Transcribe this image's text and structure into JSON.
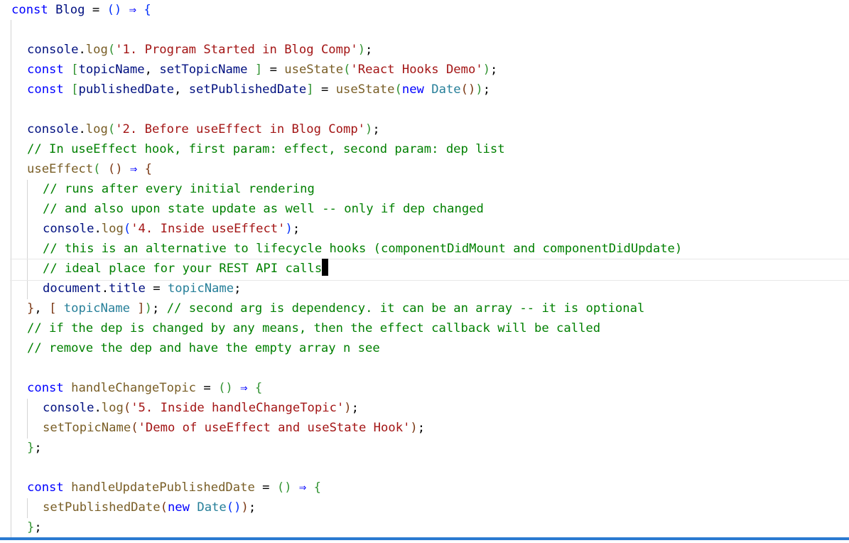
{
  "editor": {
    "language": "javascript",
    "lines": [
      {
        "tokens": [
          {
            "t": "const",
            "c": "k"
          },
          {
            "t": " ",
            "c": "p"
          },
          {
            "t": "Blog",
            "c": "v"
          },
          {
            "t": " = ",
            "c": "p"
          },
          {
            "t": "()",
            "c": "b1"
          },
          {
            "t": " ",
            "c": "p"
          },
          {
            "t": "⇒",
            "c": "k"
          },
          {
            "t": " ",
            "c": "p"
          },
          {
            "t": "{",
            "c": "b1"
          }
        ]
      },
      {
        "tokens": []
      },
      {
        "tokens": [
          {
            "t": "console",
            "c": "v"
          },
          {
            "t": ".",
            "c": "p"
          },
          {
            "t": "log",
            "c": "f"
          },
          {
            "t": "(",
            "c": "b2"
          },
          {
            "t": "'1. Program Started in Blog Comp'",
            "c": "s"
          },
          {
            "t": ")",
            "c": "b2"
          },
          {
            "t": ";",
            "c": "p"
          }
        ]
      },
      {
        "tokens": [
          {
            "t": "const",
            "c": "k"
          },
          {
            "t": " ",
            "c": "p"
          },
          {
            "t": "[",
            "c": "b2"
          },
          {
            "t": "topicName",
            "c": "v"
          },
          {
            "t": ", ",
            "c": "p"
          },
          {
            "t": "setTopicName",
            "c": "v"
          },
          {
            "t": " ",
            "c": "p"
          },
          {
            "t": "]",
            "c": "b2"
          },
          {
            "t": " = ",
            "c": "p"
          },
          {
            "t": "useState",
            "c": "f"
          },
          {
            "t": "(",
            "c": "b2"
          },
          {
            "t": "'React Hooks Demo'",
            "c": "s"
          },
          {
            "t": ")",
            "c": "b2"
          },
          {
            "t": ";",
            "c": "p"
          }
        ]
      },
      {
        "tokens": [
          {
            "t": "const",
            "c": "k"
          },
          {
            "t": " ",
            "c": "p"
          },
          {
            "t": "[",
            "c": "b2"
          },
          {
            "t": "publishedDate",
            "c": "v"
          },
          {
            "t": ", ",
            "c": "p"
          },
          {
            "t": "setPublishedDate",
            "c": "v"
          },
          {
            "t": "]",
            "c": "b2"
          },
          {
            "t": " = ",
            "c": "p"
          },
          {
            "t": "useState",
            "c": "f"
          },
          {
            "t": "(",
            "c": "b2"
          },
          {
            "t": "new",
            "c": "k"
          },
          {
            "t": " ",
            "c": "p"
          },
          {
            "t": "Date",
            "c": "t"
          },
          {
            "t": "()",
            "c": "b3"
          },
          {
            "t": ")",
            "c": "b2"
          },
          {
            "t": ";",
            "c": "p"
          }
        ]
      },
      {
        "tokens": []
      },
      {
        "tokens": [
          {
            "t": "console",
            "c": "v"
          },
          {
            "t": ".",
            "c": "p"
          },
          {
            "t": "log",
            "c": "f"
          },
          {
            "t": "(",
            "c": "b2"
          },
          {
            "t": "'2. Before useEffect in Blog Comp'",
            "c": "s"
          },
          {
            "t": ")",
            "c": "b2"
          },
          {
            "t": ";",
            "c": "p"
          }
        ]
      },
      {
        "tokens": [
          {
            "t": "// In useEffect hook, first param: effect, second param: dep list",
            "c": "c"
          }
        ]
      },
      {
        "tokens": [
          {
            "t": "useEffect",
            "c": "f"
          },
          {
            "t": "(",
            "c": "b2"
          },
          {
            "t": " ",
            "c": "p"
          },
          {
            "t": "()",
            "c": "b3"
          },
          {
            "t": " ",
            "c": "p"
          },
          {
            "t": "⇒",
            "c": "k"
          },
          {
            "t": " ",
            "c": "p"
          },
          {
            "t": "{",
            "c": "b3"
          }
        ]
      },
      {
        "tokens": [
          {
            "t": "// runs after every initial rendering",
            "c": "c"
          }
        ]
      },
      {
        "tokens": [
          {
            "t": "// and also upon state update as well -- only if dep changed",
            "c": "c"
          }
        ]
      },
      {
        "tokens": [
          {
            "t": "console",
            "c": "v"
          },
          {
            "t": ".",
            "c": "p"
          },
          {
            "t": "log",
            "c": "f"
          },
          {
            "t": "(",
            "c": "b1"
          },
          {
            "t": "'4. Inside useEffect'",
            "c": "s"
          },
          {
            "t": ")",
            "c": "b1"
          },
          {
            "t": ";",
            "c": "p"
          }
        ]
      },
      {
        "tokens": [
          {
            "t": "// this is an alternative to lifecycle hooks (componentDidMount and componentDidUpdate)",
            "c": "c"
          }
        ]
      },
      {
        "tokens": [
          {
            "t": "// ideal place for your REST API calls",
            "c": "c"
          }
        ]
      },
      {
        "tokens": [
          {
            "t": "document",
            "c": "v"
          },
          {
            "t": ".",
            "c": "p"
          },
          {
            "t": "title",
            "c": "v"
          },
          {
            "t": " = ",
            "c": "p"
          },
          {
            "t": "topicName",
            "c": "t"
          },
          {
            "t": ";",
            "c": "p"
          }
        ]
      },
      {
        "tokens": [
          {
            "t": "}",
            "c": "b3"
          },
          {
            "t": ", ",
            "c": "p"
          },
          {
            "t": "[",
            "c": "b3"
          },
          {
            "t": " ",
            "c": "p"
          },
          {
            "t": "topicName",
            "c": "t"
          },
          {
            "t": " ",
            "c": "p"
          },
          {
            "t": "]",
            "c": "b3"
          },
          {
            "t": ")",
            "c": "b2"
          },
          {
            "t": "; ",
            "c": "p"
          },
          {
            "t": "// second arg is dependency. it can be an array -- it is optional",
            "c": "c"
          }
        ]
      },
      {
        "tokens": [
          {
            "t": "// if the dep is changed by any means, then the effect callback will be called",
            "c": "c"
          }
        ]
      },
      {
        "tokens": [
          {
            "t": "// remove the dep and have the empty array n see",
            "c": "c"
          }
        ]
      },
      {
        "tokens": []
      },
      {
        "tokens": [
          {
            "t": "const",
            "c": "k"
          },
          {
            "t": " ",
            "c": "p"
          },
          {
            "t": "handleChangeTopic",
            "c": "f"
          },
          {
            "t": " = ",
            "c": "p"
          },
          {
            "t": "()",
            "c": "b2"
          },
          {
            "t": " ",
            "c": "p"
          },
          {
            "t": "⇒",
            "c": "k"
          },
          {
            "t": " ",
            "c": "p"
          },
          {
            "t": "{",
            "c": "b2"
          }
        ]
      },
      {
        "tokens": [
          {
            "t": "console",
            "c": "v"
          },
          {
            "t": ".",
            "c": "p"
          },
          {
            "t": "log",
            "c": "f"
          },
          {
            "t": "(",
            "c": "b3"
          },
          {
            "t": "'5. Inside handleChangeTopic'",
            "c": "s"
          },
          {
            "t": ")",
            "c": "b3"
          },
          {
            "t": ";",
            "c": "p"
          }
        ]
      },
      {
        "tokens": [
          {
            "t": "setTopicName",
            "c": "f"
          },
          {
            "t": "(",
            "c": "b3"
          },
          {
            "t": "'Demo of useEffect and useState Hook'",
            "c": "s"
          },
          {
            "t": ")",
            "c": "b3"
          },
          {
            "t": ";",
            "c": "p"
          }
        ]
      },
      {
        "tokens": [
          {
            "t": "}",
            "c": "b2"
          },
          {
            "t": ";",
            "c": "p"
          }
        ]
      },
      {
        "tokens": []
      },
      {
        "tokens": [
          {
            "t": "const",
            "c": "k"
          },
          {
            "t": " ",
            "c": "p"
          },
          {
            "t": "handleUpdatePublishedDate",
            "c": "f"
          },
          {
            "t": " = ",
            "c": "p"
          },
          {
            "t": "()",
            "c": "b2"
          },
          {
            "t": " ",
            "c": "p"
          },
          {
            "t": "⇒",
            "c": "k"
          },
          {
            "t": " ",
            "c": "p"
          },
          {
            "t": "{",
            "c": "b2"
          }
        ]
      },
      {
        "tokens": [
          {
            "t": "setPublishedDate",
            "c": "f"
          },
          {
            "t": "(",
            "c": "b3"
          },
          {
            "t": "new",
            "c": "k"
          },
          {
            "t": " ",
            "c": "p"
          },
          {
            "t": "Date",
            "c": "t"
          },
          {
            "t": "()",
            "c": "b1"
          },
          {
            "t": ")",
            "c": "b3"
          },
          {
            "t": ";",
            "c": "p"
          }
        ]
      },
      {
        "tokens": [
          {
            "t": "}",
            "c": "b2"
          },
          {
            "t": ";",
            "c": "p"
          }
        ]
      }
    ]
  }
}
